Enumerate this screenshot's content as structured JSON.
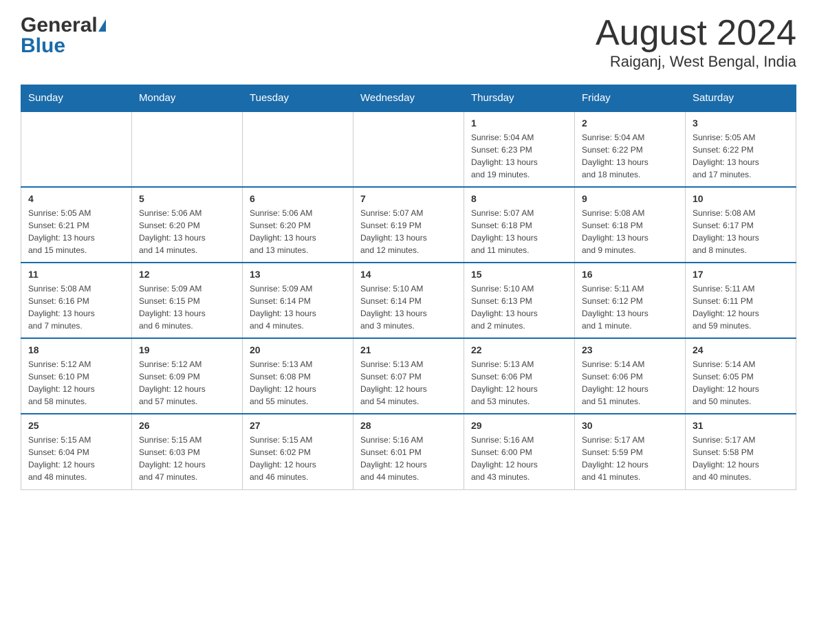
{
  "header": {
    "logo_general": "General",
    "logo_blue": "Blue",
    "month_title": "August 2024",
    "location": "Raiganj, West Bengal, India"
  },
  "calendar": {
    "days_of_week": [
      "Sunday",
      "Monday",
      "Tuesday",
      "Wednesday",
      "Thursday",
      "Friday",
      "Saturday"
    ],
    "weeks": [
      [
        {
          "day": "",
          "info": ""
        },
        {
          "day": "",
          "info": ""
        },
        {
          "day": "",
          "info": ""
        },
        {
          "day": "",
          "info": ""
        },
        {
          "day": "1",
          "info": "Sunrise: 5:04 AM\nSunset: 6:23 PM\nDaylight: 13 hours\nand 19 minutes."
        },
        {
          "day": "2",
          "info": "Sunrise: 5:04 AM\nSunset: 6:22 PM\nDaylight: 13 hours\nand 18 minutes."
        },
        {
          "day": "3",
          "info": "Sunrise: 5:05 AM\nSunset: 6:22 PM\nDaylight: 13 hours\nand 17 minutes."
        }
      ],
      [
        {
          "day": "4",
          "info": "Sunrise: 5:05 AM\nSunset: 6:21 PM\nDaylight: 13 hours\nand 15 minutes."
        },
        {
          "day": "5",
          "info": "Sunrise: 5:06 AM\nSunset: 6:20 PM\nDaylight: 13 hours\nand 14 minutes."
        },
        {
          "day": "6",
          "info": "Sunrise: 5:06 AM\nSunset: 6:20 PM\nDaylight: 13 hours\nand 13 minutes."
        },
        {
          "day": "7",
          "info": "Sunrise: 5:07 AM\nSunset: 6:19 PM\nDaylight: 13 hours\nand 12 minutes."
        },
        {
          "day": "8",
          "info": "Sunrise: 5:07 AM\nSunset: 6:18 PM\nDaylight: 13 hours\nand 11 minutes."
        },
        {
          "day": "9",
          "info": "Sunrise: 5:08 AM\nSunset: 6:18 PM\nDaylight: 13 hours\nand 9 minutes."
        },
        {
          "day": "10",
          "info": "Sunrise: 5:08 AM\nSunset: 6:17 PM\nDaylight: 13 hours\nand 8 minutes."
        }
      ],
      [
        {
          "day": "11",
          "info": "Sunrise: 5:08 AM\nSunset: 6:16 PM\nDaylight: 13 hours\nand 7 minutes."
        },
        {
          "day": "12",
          "info": "Sunrise: 5:09 AM\nSunset: 6:15 PM\nDaylight: 13 hours\nand 6 minutes."
        },
        {
          "day": "13",
          "info": "Sunrise: 5:09 AM\nSunset: 6:14 PM\nDaylight: 13 hours\nand 4 minutes."
        },
        {
          "day": "14",
          "info": "Sunrise: 5:10 AM\nSunset: 6:14 PM\nDaylight: 13 hours\nand 3 minutes."
        },
        {
          "day": "15",
          "info": "Sunrise: 5:10 AM\nSunset: 6:13 PM\nDaylight: 13 hours\nand 2 minutes."
        },
        {
          "day": "16",
          "info": "Sunrise: 5:11 AM\nSunset: 6:12 PM\nDaylight: 13 hours\nand 1 minute."
        },
        {
          "day": "17",
          "info": "Sunrise: 5:11 AM\nSunset: 6:11 PM\nDaylight: 12 hours\nand 59 minutes."
        }
      ],
      [
        {
          "day": "18",
          "info": "Sunrise: 5:12 AM\nSunset: 6:10 PM\nDaylight: 12 hours\nand 58 minutes."
        },
        {
          "day": "19",
          "info": "Sunrise: 5:12 AM\nSunset: 6:09 PM\nDaylight: 12 hours\nand 57 minutes."
        },
        {
          "day": "20",
          "info": "Sunrise: 5:13 AM\nSunset: 6:08 PM\nDaylight: 12 hours\nand 55 minutes."
        },
        {
          "day": "21",
          "info": "Sunrise: 5:13 AM\nSunset: 6:07 PM\nDaylight: 12 hours\nand 54 minutes."
        },
        {
          "day": "22",
          "info": "Sunrise: 5:13 AM\nSunset: 6:06 PM\nDaylight: 12 hours\nand 53 minutes."
        },
        {
          "day": "23",
          "info": "Sunrise: 5:14 AM\nSunset: 6:06 PM\nDaylight: 12 hours\nand 51 minutes."
        },
        {
          "day": "24",
          "info": "Sunrise: 5:14 AM\nSunset: 6:05 PM\nDaylight: 12 hours\nand 50 minutes."
        }
      ],
      [
        {
          "day": "25",
          "info": "Sunrise: 5:15 AM\nSunset: 6:04 PM\nDaylight: 12 hours\nand 48 minutes."
        },
        {
          "day": "26",
          "info": "Sunrise: 5:15 AM\nSunset: 6:03 PM\nDaylight: 12 hours\nand 47 minutes."
        },
        {
          "day": "27",
          "info": "Sunrise: 5:15 AM\nSunset: 6:02 PM\nDaylight: 12 hours\nand 46 minutes."
        },
        {
          "day": "28",
          "info": "Sunrise: 5:16 AM\nSunset: 6:01 PM\nDaylight: 12 hours\nand 44 minutes."
        },
        {
          "day": "29",
          "info": "Sunrise: 5:16 AM\nSunset: 6:00 PM\nDaylight: 12 hours\nand 43 minutes."
        },
        {
          "day": "30",
          "info": "Sunrise: 5:17 AM\nSunset: 5:59 PM\nDaylight: 12 hours\nand 41 minutes."
        },
        {
          "day": "31",
          "info": "Sunrise: 5:17 AM\nSunset: 5:58 PM\nDaylight: 12 hours\nand 40 minutes."
        }
      ]
    ]
  }
}
